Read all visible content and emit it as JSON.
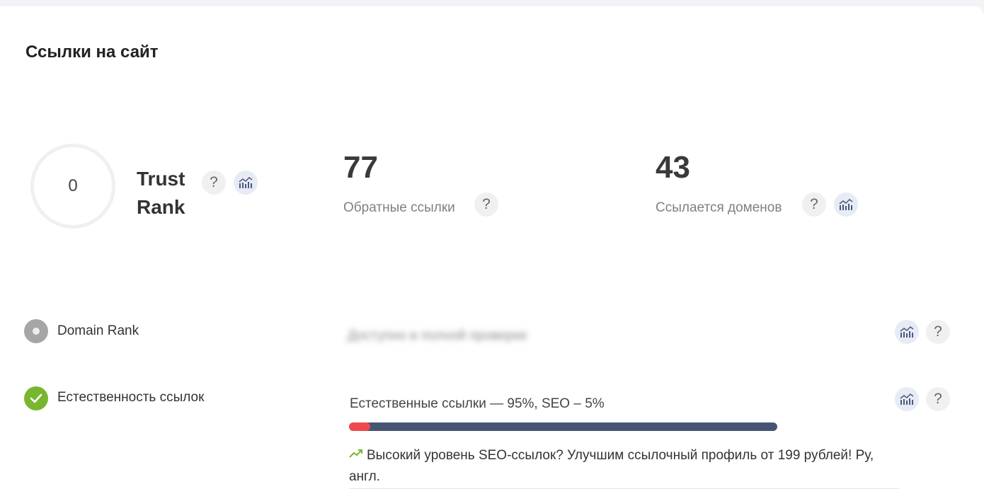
{
  "section": {
    "title": "Ссылки на сайт"
  },
  "trust_rank": {
    "value": "0",
    "label": "Trust Rank",
    "help_icon": "?",
    "chart_icon": "bar-chart-trend-icon"
  },
  "backlinks": {
    "value": "77",
    "label": "Обратные ссылки",
    "help_icon": "?"
  },
  "referring_domains": {
    "value": "43",
    "label": "Ссылается доменов",
    "help_icon": "?",
    "chart_icon": "bar-chart-trend-icon"
  },
  "domain_rank": {
    "label": "Domain Rank",
    "status": "neutral",
    "hidden_value": "Доступно в полной проверке",
    "help_icon": "?",
    "chart_icon": "bar-chart-trend-icon"
  },
  "link_naturalness": {
    "label": "Естественность ссылок",
    "status": "ok",
    "ratio_text": "Естественные ссылки — 95%, SEO – 5%",
    "natural_percent": 95,
    "seo_percent": 5,
    "promo_text": "Высокий уровень SEO-ссылок? Улучшим ссылочный профиль от 199 рублей! Ру, англ.",
    "promo_icon": "trending-up-icon",
    "help_icon": "?",
    "chart_icon": "bar-chart-trend-icon"
  },
  "colors": {
    "status_ok": "#77b72f",
    "status_neutral": "#a6a6a6",
    "bar_natural": "#465574",
    "bar_seo": "#f0484f",
    "trend_green": "#77b72f"
  }
}
